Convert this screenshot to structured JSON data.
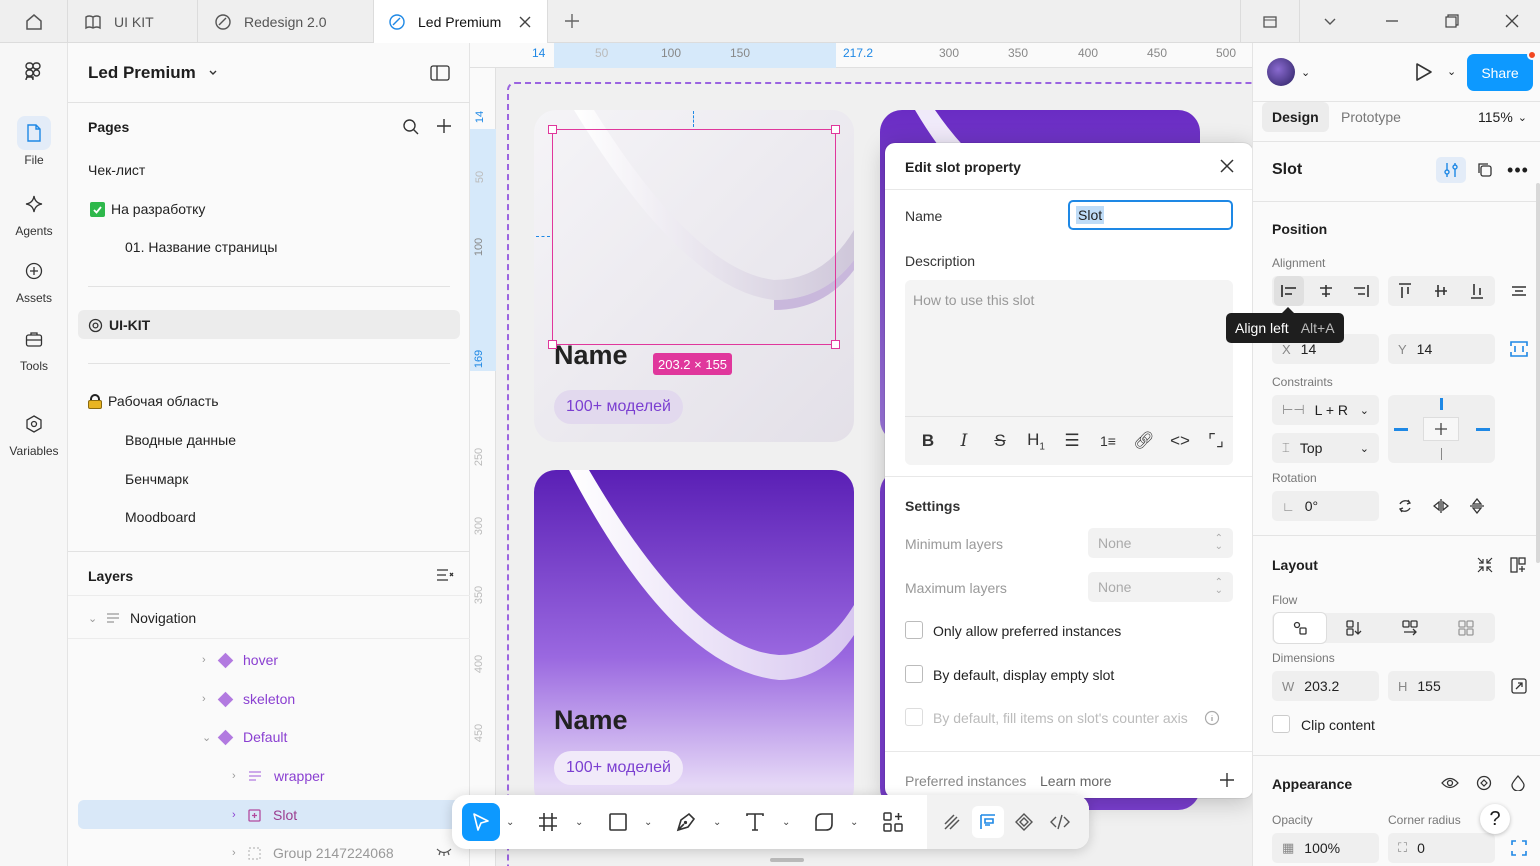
{
  "tabs": {
    "items": [
      {
        "label": "UI KIT"
      },
      {
        "label": "Redesign 2.0"
      },
      {
        "label": "Led Premium"
      }
    ]
  },
  "rail": {
    "file": "File",
    "agents": "Agents",
    "assets": "Assets",
    "tools": "Tools",
    "variables": "Variables"
  },
  "file": {
    "name": "Led Premium"
  },
  "pages": {
    "title": "Pages",
    "items": [
      {
        "label": "Чек-лист"
      },
      {
        "label": "На разработку"
      },
      {
        "label": "01. Название страницы"
      },
      {
        "label": "UI-KIT"
      },
      {
        "label": "Рабочая область"
      },
      {
        "label": "Вводные данные"
      },
      {
        "label": "Бенчмарк"
      },
      {
        "label": "Moodboard"
      }
    ]
  },
  "layers": {
    "title": "Layers",
    "items": [
      {
        "label": "Novigation"
      },
      {
        "label": "hover"
      },
      {
        "label": "skeleton"
      },
      {
        "label": "Default"
      },
      {
        "label": "wrapper"
      },
      {
        "label": "Slot"
      },
      {
        "label": "Group 2147224068"
      }
    ]
  },
  "ruler": {
    "top": [
      "14",
      "50",
      "100",
      "150",
      "217.2",
      "300",
      "350",
      "400",
      "450",
      "500"
    ],
    "left": [
      "14",
      "50",
      "100",
      "169",
      "250",
      "300",
      "350",
      "400",
      "450"
    ]
  },
  "canvas": {
    "card1_name": "Name",
    "card1_badge": "100+ моделей",
    "card2_name": "Name",
    "card2_badge": "100+ моделей",
    "size_badge": "203.2 × 155"
  },
  "dialog": {
    "title": "Edit slot property",
    "name_label": "Name",
    "name_value": "Slot",
    "description_label": "Description",
    "description_placeholder": "How to use this slot",
    "settings_label": "Settings",
    "min_layers_label": "Minimum layers",
    "min_layers_value": "None",
    "max_layers_label": "Maximum layers",
    "max_layers_value": "None",
    "opt1": "Only allow preferred instances",
    "opt2": "By default, display empty slot",
    "opt3": "By default, fill items on slot's counter axis",
    "preferred_label": "Preferred instances",
    "learn_more": "Learn more"
  },
  "right": {
    "share": "Share",
    "tab_design": "Design",
    "tab_prototype": "Prototype",
    "zoom": "115%",
    "selection": "Slot",
    "position": "Position",
    "alignment": "Alignment",
    "tooltip_label": "Align left",
    "tooltip_shortcut": "Alt+A",
    "x_label": "X",
    "x_value": "14",
    "y_label": "Y",
    "y_value": "14",
    "constraints": "Constraints",
    "constraint_h": "L + R",
    "constraint_v": "Top",
    "rotation": "Rotation",
    "rotation_value": "0°",
    "layout": "Layout",
    "flow": "Flow",
    "dimensions": "Dimensions",
    "w_label": "W",
    "w_value": "203.2",
    "h_label": "H",
    "h_value": "155",
    "clip": "Clip content",
    "appearance": "Appearance",
    "opacity": "Opacity",
    "opacity_value": "100%",
    "corner": "Corner radius",
    "corner_value": "0",
    "help": "?"
  },
  "colors": {
    "accent": "#0d99ff",
    "selection": "#e0379c",
    "purple": "#7b3fd1",
    "layer_text": "#8a3fd1"
  }
}
